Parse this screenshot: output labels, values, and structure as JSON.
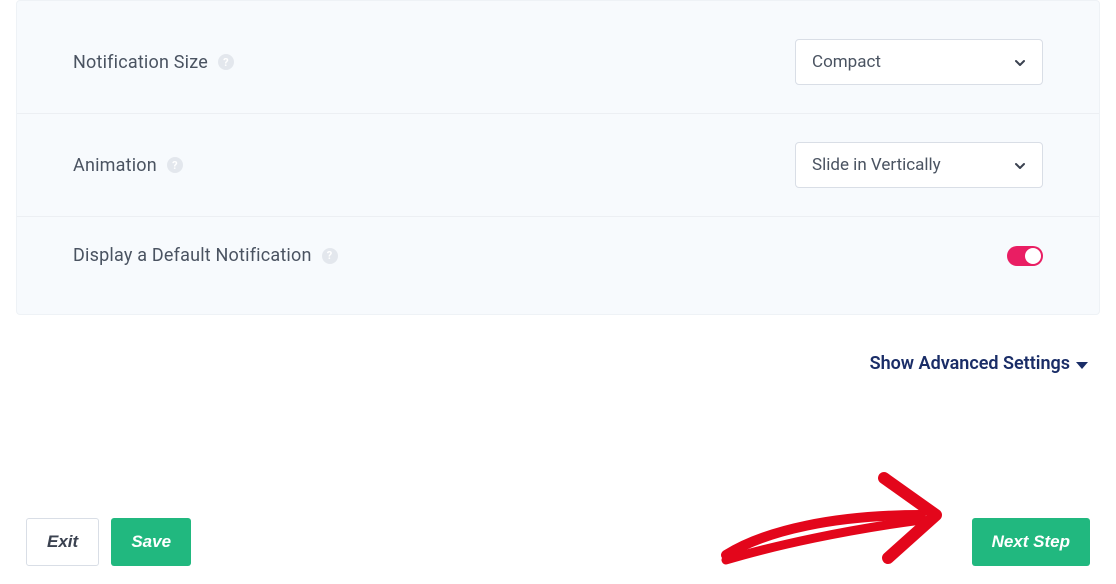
{
  "settings": {
    "notification_size": {
      "label": "Notification Size",
      "value": "Compact"
    },
    "animation": {
      "label": "Animation",
      "value": "Slide in Vertically"
    },
    "default_notification": {
      "label": "Display a Default Notification",
      "enabled": true
    }
  },
  "advanced_link": "Show Advanced Settings",
  "footer": {
    "exit": "Exit",
    "save": "Save",
    "next": "Next Step"
  }
}
